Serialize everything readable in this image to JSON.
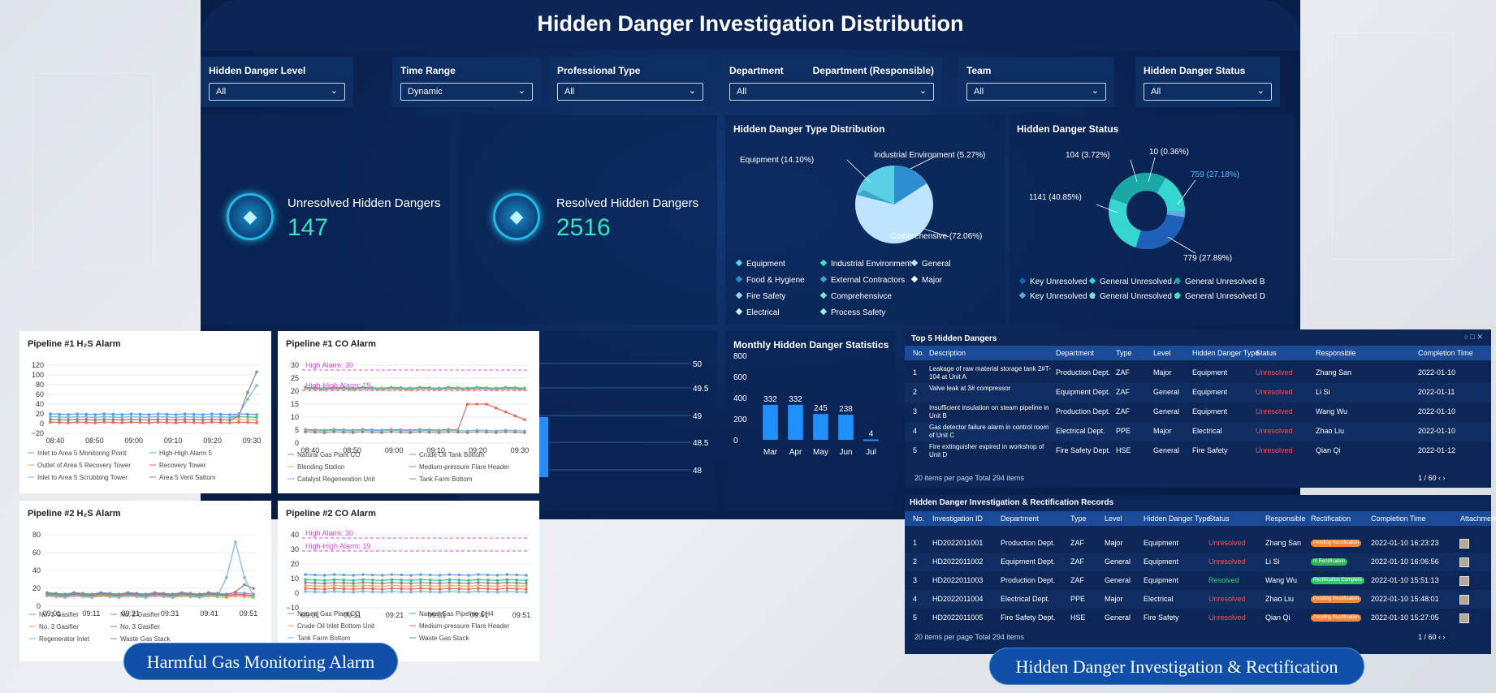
{
  "title": "Hidden Danger Investigation Distribution",
  "filters": [
    {
      "label": "Hidden Danger Level",
      "value": "All"
    },
    {
      "label": "Time Range",
      "value": "Dynamic"
    },
    {
      "label": "Professional Type",
      "value": "All"
    },
    {
      "label": "Department",
      "label2": "Department (Responsible)",
      "value": "All"
    },
    {
      "label": "Team",
      "value": "All"
    },
    {
      "label": "Hidden Danger Status",
      "value": "All"
    }
  ],
  "kpis": {
    "unresolved_label": "Unresolved Hidden Dangers",
    "unresolved_value": "147",
    "resolved_label": "Resolved Hidden Dangers",
    "resolved_value": "2516"
  },
  "type_dist": {
    "title": "Hidden Danger Type Distribution",
    "labels": {
      "equipment": "Equipment (14.10%)",
      "industrial": "Industrial Environment (5.27%)",
      "comprehensive": "Comprehensive (72.06%)"
    },
    "legend": [
      "Equipment",
      "Industrial Environment",
      "General",
      "Food & Hygiene",
      "External Contractors",
      "Major",
      "Fire Safety",
      "Comprehensivce",
      "Electrical",
      "Process Safety"
    ]
  },
  "status_dist": {
    "title": "Hidden Danger Status",
    "labels": {
      "a": "104 (3.72%)",
      "b": "10 (0.36%)",
      "c": "759 (27.18%)",
      "d": "1141 (40.85%)",
      "e": "779 (27.89%)"
    },
    "legend": [
      "Key Unresolved",
      "General Unresolved A",
      "General Unresolved B",
      "Key Unresolved C",
      "General Unresolved C",
      "General Unresolved D"
    ]
  },
  "side_axis": [
    "50",
    "49.5",
    "49",
    "48.5",
    "48"
  ],
  "monthly": {
    "title": "Monthly Hidden Danger Statistics"
  },
  "chart_data": [
    {
      "type": "bar",
      "title": "Monthly Hidden Danger Statistics",
      "categories": [
        "Mar",
        "Apr",
        "May",
        "Jun",
        "Jul"
      ],
      "values": [
        332,
        332,
        245,
        238,
        4
      ],
      "ylim": [
        0,
        800
      ],
      "yticks": [
        "0",
        "200",
        "400",
        "600",
        "800"
      ]
    },
    {
      "type": "pie",
      "title": "Hidden Danger Type Distribution",
      "slices": [
        {
          "label": "Comprehensive",
          "value": 72.06
        },
        {
          "label": "Equipment",
          "value": 14.1
        },
        {
          "label": "Industrial Environment",
          "value": 5.27
        }
      ]
    },
    {
      "type": "pie",
      "title": "Hidden Danger Status",
      "slices": [
        {
          "label": "104",
          "value": 3.72
        },
        {
          "label": "10",
          "value": 0.36
        },
        {
          "label": "759",
          "value": 27.18
        },
        {
          "label": "779",
          "value": 27.89
        },
        {
          "label": "1141",
          "value": 40.85
        }
      ]
    }
  ],
  "gas": {
    "h2s1": {
      "title": "Pipeline #1 H₂S Alarm",
      "yticks": [
        "120",
        "100",
        "80",
        "60",
        "40",
        "20",
        "0",
        "−20"
      ],
      "xticks": [
        "08:40",
        "08:50",
        "09:00",
        "09:10",
        "09:20",
        "09:30"
      ],
      "legend": [
        "Inlet to Area 5 Monitoring Point",
        "High-High Alarm 5",
        "Outlet of Area 5 Recovery Tower",
        "Recovery Tower",
        "Inlet to Area 5 Scrubbing Tower",
        "Area 5 Vent Sattom"
      ]
    },
    "co1": {
      "title": "Pipeline #1 CO Alarm",
      "high": "High Alarm:  30",
      "highhigh": "High-High Alarm: 19",
      "yticks": [
        "30",
        "25",
        "20",
        "15",
        "10",
        "5",
        "0"
      ],
      "xticks": [
        "08:40",
        "08:50",
        "09:00",
        "09:10",
        "09:20",
        "09:30"
      ],
      "legend": [
        "Natural Gas Plant CO",
        "Crude Oil Tank Bottom",
        "Blending Station",
        "Medium-pressure Flare Header",
        "Catalyst Regeneration Unit",
        "Tank Farm Bottom"
      ]
    },
    "h2s2": {
      "title": "Pipeline #2 H₂S Alarm",
      "yticks": [
        "80",
        "60",
        "40",
        "20",
        "0"
      ],
      "xticks": [
        "09:01",
        "09:11",
        "09:21",
        "09:31",
        "09:41",
        "09:51"
      ],
      "legend": [
        "No. 1 Gasifier",
        "No. 2 Gasifier",
        "No. 3 Gasifier",
        "No. 3 Gasifier",
        "Regenerator Inlet",
        "Waste Gas Stack"
      ]
    },
    "co2": {
      "title": "Pipeline #2 CO Alarm",
      "high": "High Alarm:  30",
      "highhigh": "High-High Alarm: 19",
      "yticks": [
        "40",
        "30",
        "20",
        "10",
        "0",
        "−10"
      ],
      "xticks": [
        "09:01",
        "09:11",
        "09:21",
        "09:31",
        "09:41",
        "09:51"
      ],
      "legend": [
        "Natural Gas Plant CO",
        "Natural Gas Pipeline CH4",
        "Crude Oil Inlet Bottom Unit",
        "Medium-pressure Flare Header",
        "Tank Farm Bottom",
        "Waste Gas Stack"
      ]
    }
  },
  "top5": {
    "title": "Top 5 Hidden Dangers",
    "headers": [
      "No.",
      "Description",
      "Department",
      "Type",
      "Level",
      "Hidden Danger Type",
      "Status",
      "Responsible",
      "Completion Time"
    ],
    "rows": [
      [
        "1",
        "Leakage of raw material storage tank 2#T-104 at Unit A",
        "Production Dept.",
        "ZAF",
        "Major",
        "Equipment",
        "Unresolved",
        "Zhang San",
        "2022-01-10"
      ],
      [
        "2",
        "Valve leak at 3# compressor",
        "Equipment Dept.",
        "ZAF",
        "General",
        "Equipment",
        "Unresolved",
        "Li Si",
        "2022-01-11"
      ],
      [
        "3",
        "Insufficient insulation on steam pipeline in Unit B",
        "Production Dept.",
        "ZAF",
        "General",
        "Equipment",
        "Unresolved",
        "Wang Wu",
        "2022-01-10"
      ],
      [
        "4",
        "Gas detector failure alarm in control room of Unit C",
        "Electrical Dept.",
        "PPE",
        "Major",
        "Electrical",
        "Unresolved",
        "Zhao Liu",
        "2022-01-10"
      ],
      [
        "5",
        "Fire extinguisher expired in workshop of Unit D",
        "Fire Safety Dept.",
        "HSE",
        "General",
        "Fire Safety",
        "Unresolved",
        "Qian Qi",
        "2022-01-12"
      ]
    ],
    "footer": "20 items per page     Total 294 items",
    "pages": "1 / 60"
  },
  "records": {
    "title": "Hidden Danger Investigation & Rectification Records",
    "headers": [
      "No.",
      "Investigation ID",
      "Department",
      "Type",
      "Level",
      "Hidden Danger Type",
      "Status",
      "Responsible",
      "Rectification",
      "Completion Time",
      "Attachments"
    ],
    "rows": [
      [
        "1",
        "HD2022011001",
        "Production Dept.",
        "ZAF",
        "Major",
        "Equipment",
        "Unresolved",
        "Zhang San",
        "Pending Rectification",
        "2022-01-10 16:23:23"
      ],
      [
        "2",
        "HD2022011002",
        "Equipment Dept.",
        "ZAF",
        "General",
        "Equipment",
        "Unresolved",
        "Li Si",
        "In Rectification",
        "2022-01-10 16:06:56"
      ],
      [
        "3",
        "HD2022011003",
        "Production Dept.",
        "ZAF",
        "General",
        "Equipment",
        "Resolved",
        "Wang Wu",
        "Rectification Complete",
        "2022-01-10 15:51:13"
      ],
      [
        "4",
        "HD2022011004",
        "Electrical Dept.",
        "PPE",
        "Major",
        "Electrical",
        "Unresolved",
        "Zhao Liu",
        "Pending Rectification",
        "2022-01-10 15:48:01"
      ],
      [
        "5",
        "HD2022011005",
        "Fire Safety Dept.",
        "HSE",
        "General",
        "Fire Safety",
        "Unresolved",
        "Qian Qi",
        "Pending Rectification",
        "2022-01-10 15:27:05"
      ]
    ],
    "footer": "20 items per page     Total 294 items",
    "pages": "1 / 60"
  },
  "captions": {
    "left": "Harmful Gas Monitoring Alarm",
    "right": "Hidden Danger Investigation & Rectification"
  },
  "colors": {
    "accent": "#2ee6c0",
    "unresolved": "#ff4d4f",
    "resolved": "#33d17a",
    "bar": "#1e90ff"
  }
}
